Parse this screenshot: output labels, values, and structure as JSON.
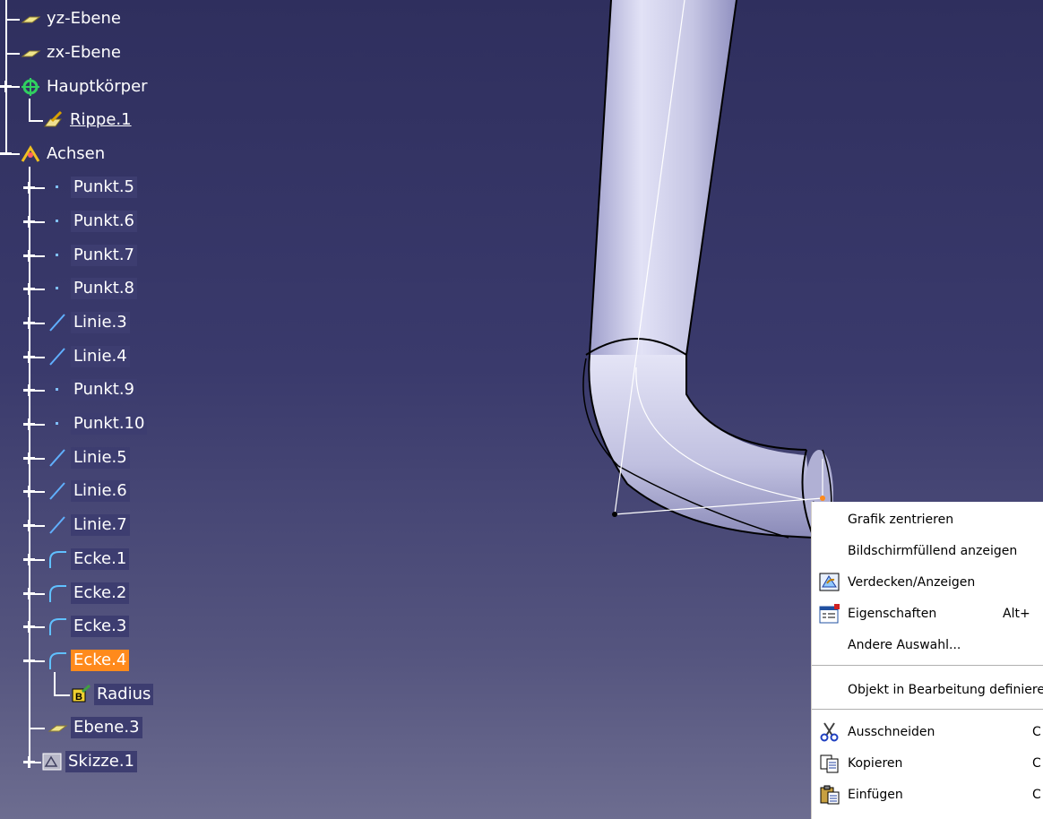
{
  "tree": {
    "items": [
      {
        "label": "yz-Ebene"
      },
      {
        "label": "zx-Ebene"
      },
      {
        "label": "Hauptkörper"
      },
      {
        "label": "Rippe.1"
      },
      {
        "label": "Achsen"
      },
      {
        "label": "Punkt.5"
      },
      {
        "label": "Punkt.6"
      },
      {
        "label": "Punkt.7"
      },
      {
        "label": "Punkt.8"
      },
      {
        "label": "Linie.3"
      },
      {
        "label": "Linie.4"
      },
      {
        "label": "Punkt.9"
      },
      {
        "label": "Punkt.10"
      },
      {
        "label": "Linie.5"
      },
      {
        "label": "Linie.6"
      },
      {
        "label": "Linie.7"
      },
      {
        "label": "Ecke.1"
      },
      {
        "label": "Ecke.2"
      },
      {
        "label": "Ecke.3"
      },
      {
        "label": "Ecke.4"
      },
      {
        "label": "Radius"
      },
      {
        "label": "Ebene.3"
      },
      {
        "label": "Skizze.1"
      }
    ],
    "selected_item": "Ecke.4"
  },
  "context_menu": {
    "items": [
      {
        "label": "Grafik zentrieren",
        "icon": ""
      },
      {
        "label": "Bildschirmfüllend anzeigen",
        "icon": ""
      },
      {
        "label": "Verdecken/Anzeigen",
        "icon": "hide-show-icon"
      },
      {
        "label": "Eigenschaften",
        "icon": "properties-icon",
        "shortcut": "Alt+"
      },
      {
        "label": "Andere Auswahl...",
        "icon": ""
      },
      {
        "label": "Objekt in Bearbeitung definiere",
        "icon": ""
      },
      {
        "label": "Ausschneiden",
        "icon": "scissors-icon",
        "shortcut": "C"
      },
      {
        "label": "Kopieren",
        "icon": "copy-icon",
        "shortcut": "C"
      },
      {
        "label": "Einfügen",
        "icon": "paste-icon",
        "shortcut": "C"
      }
    ]
  },
  "colors": {
    "background_top": "#2f2f5e",
    "background_bottom": "#6d6d90",
    "selection": "#ff8a1c",
    "pipe": "#c8c8e8"
  }
}
